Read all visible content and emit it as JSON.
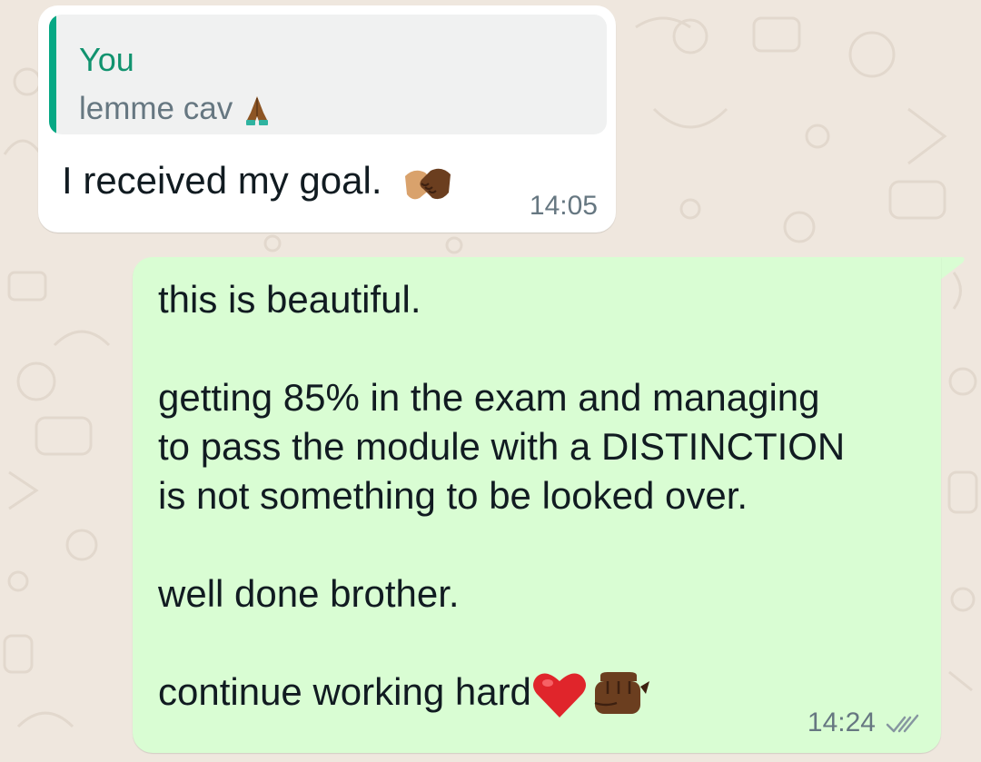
{
  "conversation": {
    "incoming": {
      "quote_author": "You",
      "quote_text": "lemme cav",
      "quote_emoji": "folded-hands-emoji",
      "text": "I received my goal.",
      "emoji": "handshake-emoji",
      "time": "14:05"
    },
    "outgoing": {
      "lines": [
        "this is beautiful.",
        "getting 85% in the exam and managing",
        "to pass the module with a DISTINCTION",
        "is not something to be looked over.",
        "well done brother.",
        "continue working hard"
      ],
      "emojis": [
        "red-heart-emoji",
        "fist-bump-emoji"
      ],
      "time": "14:24",
      "status": "read-double-check"
    }
  },
  "colors": {
    "wallpaper": "#efe7de",
    "incoming_bubble": "#ffffff",
    "outgoing_bubble": "#d9fdd3",
    "quote_accent": "#06a884",
    "read_tick": "#8696a0"
  }
}
